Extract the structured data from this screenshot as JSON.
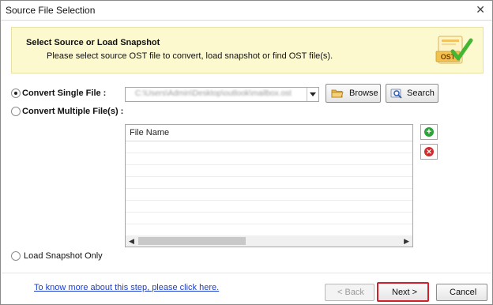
{
  "window": {
    "title": "Source File Selection",
    "close_glyph": "✕"
  },
  "banner": {
    "title": "Select Source or Load Snapshot",
    "subtitle": "Please select source OST file to convert, load snapshot or find OST file(s).",
    "logo_text": "OST",
    "logo_icon": "ost-checkmark-icon"
  },
  "options": {
    "single": {
      "label": "Convert Single File :",
      "checked": true
    },
    "multiple": {
      "label": "Convert Multiple File(s) :",
      "checked": false
    },
    "snapshot": {
      "label": "Load Snapshot Only",
      "checked": false
    }
  },
  "source_path": {
    "value": "C:\\Users\\Admin\\Desktop\\outlook\\mailbox.ost",
    "blurred": true
  },
  "buttons": {
    "browse": "Browse",
    "search": "Search",
    "back": "< Back",
    "next": "Next >",
    "cancel": "Cancel"
  },
  "file_table": {
    "columns": [
      "File Name"
    ],
    "rows": []
  },
  "help_link": "To know more about this step, please click here.",
  "colors": {
    "banner_bg": "#fdf9cf",
    "add_icon": "#2fa23a",
    "remove_icon": "#d12c2c",
    "next_highlight": "#d0202a",
    "link": "#1c3fcc"
  }
}
